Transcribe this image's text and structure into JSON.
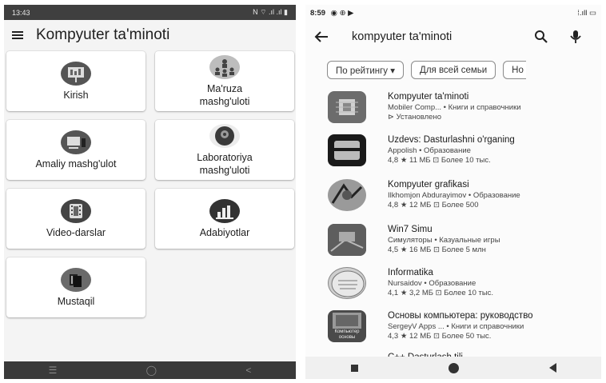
{
  "left": {
    "status": {
      "time": "13:43",
      "right": "N ⌔ .ıl .ıl ▮"
    },
    "app_title": "Kompyuter ta'minoti",
    "cards": [
      {
        "label": "Kirish",
        "icon": "presentation-board-icon"
      },
      {
        "label": "Ma'ruza\nmashg'uloti",
        "icon": "lecture-audience-icon"
      },
      {
        "label": "Amaliy mashg'ulot",
        "icon": "computer-devices-icon"
      },
      {
        "label": "Laboratoriya\nmashg'uloti",
        "icon": "gear-head-icon"
      },
      {
        "label": "Video-darslar",
        "icon": "film-strip-icon"
      },
      {
        "label": "Adabiyotlar",
        "icon": "bar-chart-icon"
      },
      {
        "label": "Mustaqil",
        "icon": "books-stack-icon"
      }
    ],
    "nav": {
      "recent": "☰",
      "home": "◯",
      "back": "<"
    }
  },
  "right": {
    "status": {
      "time": "8:59",
      "icons": "◉ ⊕ ▶",
      "right": "⁞.ıll ▭"
    },
    "search_query": "kompyuter ta'minoti",
    "chips": [
      "По рейтингу ▾",
      "Для всей семьи",
      "Но"
    ],
    "apps": [
      {
        "name": "Kompyuter ta'minoti",
        "line2": "Mobiler Comp... • Книги и справочники",
        "line3": "⊳ Установлено"
      },
      {
        "name": "Uzdevs: Dasturlashni o'rganing",
        "line2": "Appolish • Образование",
        "line3": "4,8 ★   11 МБ   ⊡ Более 10 тыс."
      },
      {
        "name": "Kompyuter grafikasi",
        "line2": "Ilkhomjon Abdurayimov • Образование",
        "line3": "4,8 ★   12 МБ   ⊡ Более 500"
      },
      {
        "name": "Win7 Simu",
        "line2": "Симуляторы • Казуальные игры",
        "line3": "4,5 ★   16 МБ   ⊡ Более 5 млн"
      },
      {
        "name": "Informatika",
        "line2": "Nursaidov • Образование",
        "line3": "4,1 ★   3,2 МБ   ⊡ Более 10 тыс."
      },
      {
        "name": "Основы компьютера: руководство",
        "line2": "SergeyV Apps ... • Книги и справочники",
        "line3": "4,3 ★   12 МБ   ⊡ Более 50 тыс."
      },
      {
        "name": "C++ Dasturlash tili",
        "line2": "",
        "line3": ""
      }
    ],
    "thumb_text_6": "Компьютер основы"
  }
}
